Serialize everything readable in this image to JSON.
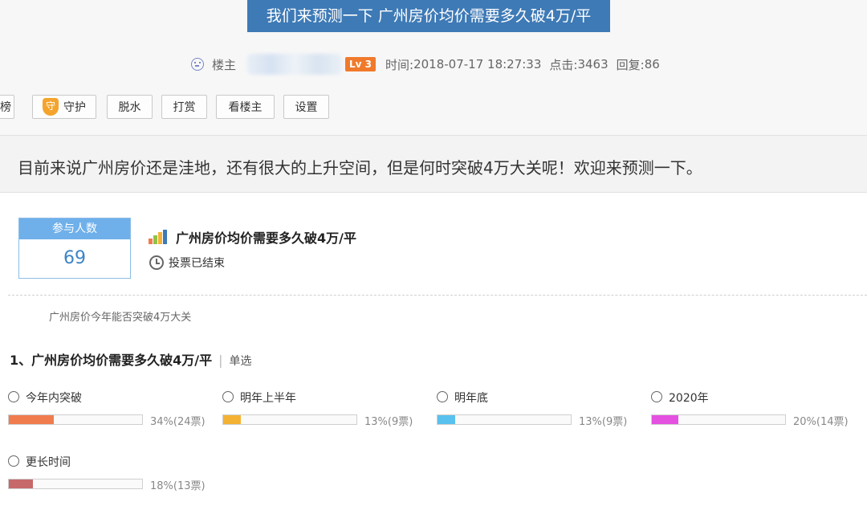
{
  "post": {
    "title": "我们来预测一下 广州房价均价需要多久破4万/平",
    "author_role": "楼主",
    "level": "Lv 3",
    "time_label": "时间:",
    "time": "2018-07-17 18:27:33",
    "views_label": "点击:",
    "views": "3463",
    "replies_label": "回复:",
    "replies": "86"
  },
  "toolbar": {
    "rank": "榜",
    "guard": "守护",
    "guard_icon_char": "守",
    "dehydrate": "脱水",
    "tip": "打赏",
    "author_only": "看楼主",
    "settings": "设置"
  },
  "lead": "目前来说广州房价还是洼地，还有很大的上升空间，但是何时突破4万大关呢！欢迎来预测一下。",
  "poll": {
    "participants_label": "参与人数",
    "participants": "69",
    "title": "广州房价均价需要多久破4万/平",
    "status": "投票已结束",
    "description": "广州房价今年能否突破4万大关",
    "question": "1、广州房价均价需要多久破4万/平",
    "question_sep": "|",
    "question_type": "单选",
    "options": [
      {
        "label": "今年内突破",
        "percent": 34,
        "stat": "34%(24票)",
        "color": "#f07c4e"
      },
      {
        "label": "明年上半年",
        "percent": 13,
        "stat": "13%(9票)",
        "color": "#f4b234"
      },
      {
        "label": "明年底",
        "percent": 13,
        "stat": "13%(9票)",
        "color": "#58c1ee"
      },
      {
        "label": "2020年",
        "percent": 20,
        "stat": "20%(14票)",
        "color": "#e450e0"
      },
      {
        "label": "更长时间",
        "percent": 18,
        "stat": "18%(13票)",
        "color": "#c7696a"
      }
    ]
  }
}
